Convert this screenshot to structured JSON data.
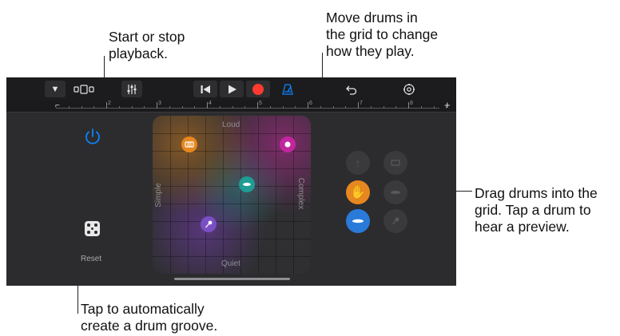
{
  "callouts": {
    "playback": "Start or stop\nplayback.",
    "grid": "Move drums in\nthe grid to change\nhow they play.",
    "drag": "Drag drums into the\ngrid. Tap a drum to\nhear a preview.",
    "groove": "Tap to automatically\ncreate a drum groove."
  },
  "ruler": {
    "bar_numbers": [
      "2",
      "3",
      "4",
      "5",
      "6",
      "7",
      "8"
    ]
  },
  "pad": {
    "top_label": "Loud",
    "bottom_label": "Quiet",
    "left_label": "Simple",
    "right_label": "Complex"
  },
  "reset": {
    "label": "Reset"
  },
  "icons": {
    "tracks_view": "track-view-icon",
    "mixer": "sliders-icon",
    "metronome": "metronome-icon",
    "undo": "undo-icon",
    "settings": "settings-icon"
  },
  "colors": {
    "record": "#ff3b30",
    "accent_blue": "#0a84ff",
    "drum_orange": "#e7871f",
    "drum_magenta": "#c2269f",
    "drum_teal": "#1f9c94",
    "drum_purple": "#7a4fc4"
  }
}
